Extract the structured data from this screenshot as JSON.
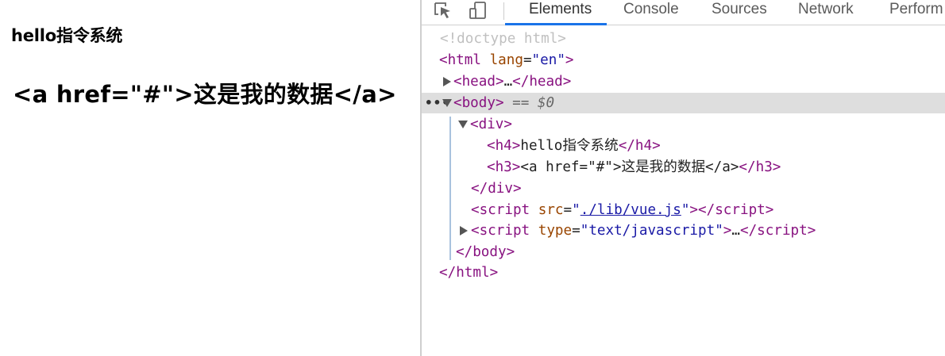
{
  "page": {
    "h4_text": "hello指令系统",
    "h3_text": "<a href=\"#\">这是我的数据</a>"
  },
  "devtools": {
    "tabs": [
      "Elements",
      "Console",
      "Sources",
      "Network",
      "Perform"
    ],
    "active_tab": "Elements",
    "accent_color": "#1a73e8",
    "icons": [
      "inspect-element-icon",
      "device-toolbar-icon"
    ]
  },
  "tree": {
    "doctype": "<!doctype html>",
    "html_open_tag": "html",
    "html_lang_attr": "lang",
    "html_lang_val": "en",
    "head_tag": "head",
    "ellipsis": "…",
    "body_tag": "body",
    "body_eq": "== $0",
    "selection_dots": "•••",
    "div_tag": "div",
    "h4_tag": "h4",
    "h4_text": "hello指令系统",
    "h3_tag": "h3",
    "h3_text": "<a href=\"#\">这是我的数据</a>",
    "script_tag": "script",
    "script_src_attr": "src",
    "script_src_val": "./lib/vue.js",
    "script2_type_attr": "type",
    "script2_type_val": "text/javascript"
  }
}
